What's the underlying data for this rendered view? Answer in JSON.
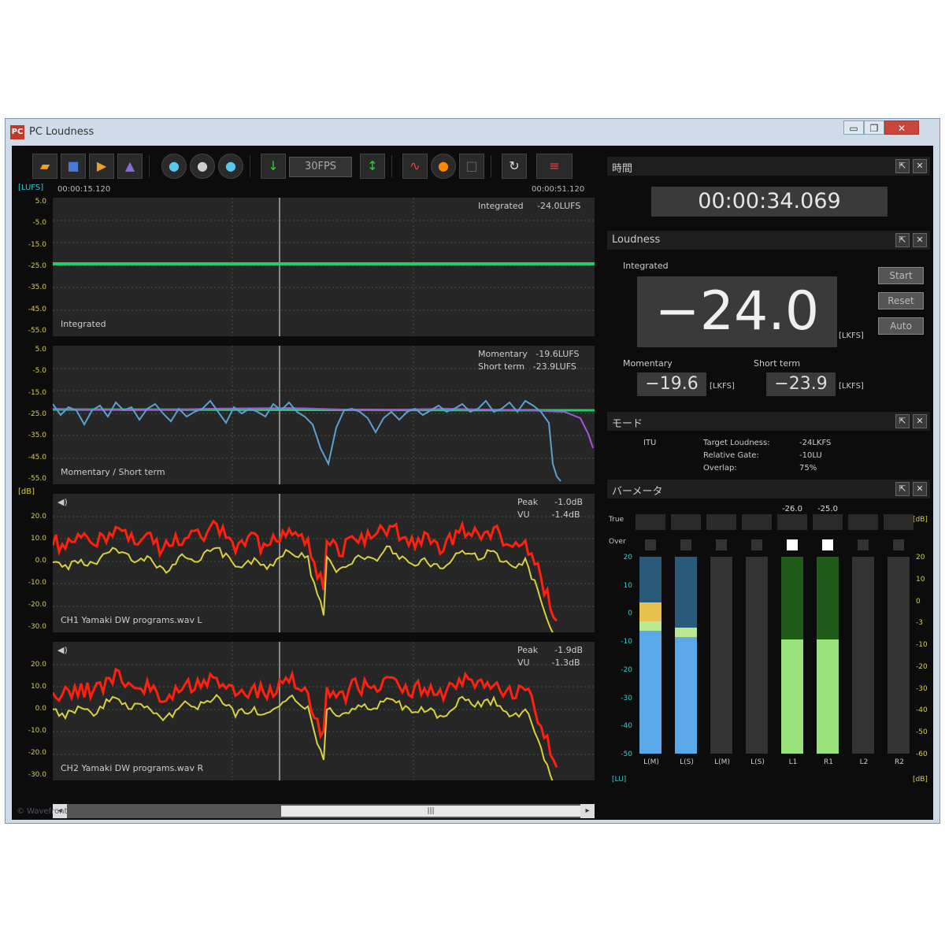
{
  "window": {
    "title": "PC Loudness",
    "app_icon": "pc-loudness-app-icon",
    "buttons": {
      "minimize": "▭",
      "maximize": "❐",
      "close": "✕"
    }
  },
  "toolbar": {
    "fps": "30FPS",
    "icons": [
      "open-folder-icon",
      "save-icon",
      "open-file-icon",
      "export-icon",
      "play-icon",
      "record-icon",
      "monitor-icon",
      "step-down-icon",
      "step-up-icon",
      "waveform-icon",
      "marker-icon",
      "blank-icon",
      "refresh-icon",
      "settings-icon"
    ]
  },
  "graph": {
    "unit_lufs": "[LUFS]",
    "unit_db": "[dB]",
    "time_start": "00:00:15.120",
    "time_end": "00:00:51.120",
    "lufs_ticks": [
      "5.0",
      "-5.0",
      "-15.0",
      "-25.0",
      "-35.0",
      "-45.0",
      "-55.0"
    ],
    "db_ticks": [
      "20.0",
      "10.0",
      "0.0",
      "-10.0",
      "-20.0",
      "-30.0"
    ],
    "integrated_panel": {
      "label": "Integrated",
      "readout": "Integrated     -24.0LUFS"
    },
    "momentary_panel": {
      "label": "Momentary / Short term",
      "readout1": "Momentary   -19.6LUFS",
      "readout2": "Short term   -23.9LUFS"
    },
    "ch1_panel": {
      "label": "CH1 Yamaki DW programs.wav L",
      "readout1": "Peak      -1.0dB",
      "readout2": "VU        -1.4dB"
    },
    "ch2_panel": {
      "label": "CH2 Yamaki DW programs.wav R",
      "readout1": "Peak      -1.9dB",
      "readout2": "VU        -1.3dB"
    }
  },
  "brand": "© Wavefront",
  "time_section": {
    "title": "時間",
    "value": "00:00:34.069"
  },
  "loudness_section": {
    "title": "Loudness",
    "integrated_label": "Integrated",
    "integrated_value": "−24.0",
    "unit": "[LKFS]",
    "momentary_label": "Momentary",
    "momentary_value": "−19.6",
    "shortterm_label": "Short term",
    "shortterm_value": "−23.9",
    "buttons": [
      "Start",
      "Reset",
      "Auto"
    ]
  },
  "mode_section": {
    "title": "モード",
    "mode": "ITU",
    "target_label": "Target Loudness:",
    "target_value": "-24LKFS",
    "gate_label": "Relative Gate:",
    "gate_value": "-10LU",
    "overlap_label": "Overlap:",
    "overlap_value": "75%"
  },
  "meter_section": {
    "title": "バーメータ",
    "true_label": "True",
    "over_label": "Over",
    "unit_left": "[LU]",
    "unit_right": "[dB]",
    "top_values": [
      "",
      "",
      "",
      "",
      "-26.0",
      "-25.0",
      "",
      ""
    ],
    "left_scale": [
      "20",
      "10",
      "0",
      "-10",
      "-20",
      "-30",
      "-40",
      "-50"
    ],
    "right_scale": [
      "20",
      "10",
      "0",
      "-3",
      "-10",
      "-20",
      "-30",
      "-40",
      "-50",
      "-60"
    ],
    "channels": [
      {
        "label": "L(M)",
        "level": 0.78,
        "over": false
      },
      {
        "label": "L(S)",
        "level": 0.74,
        "over": false
      },
      {
        "label": "L(M)",
        "level": 0.0,
        "over": false
      },
      {
        "label": "L(S)",
        "level": 0.0,
        "over": false
      },
      {
        "label": "L1",
        "level": 0.58,
        "over": true
      },
      {
        "label": "R1",
        "level": 0.58,
        "over": true
      },
      {
        "label": "L2",
        "level": 0.0,
        "over": false
      },
      {
        "label": "R2",
        "level": 0.0,
        "over": false
      }
    ]
  },
  "scrollbar": {
    "left": "◂",
    "right": "▸",
    "thumb": "|||"
  }
}
